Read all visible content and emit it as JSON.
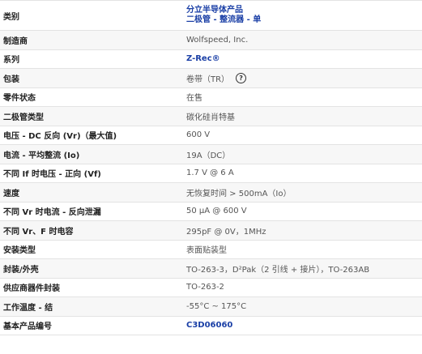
{
  "specs": [
    {
      "label": "类别",
      "value_line1": "分立半导体产品",
      "value_line2": "二极管 - 整流器 - 单"
    },
    {
      "label": "制造商",
      "value": "Wolfspeed, Inc."
    },
    {
      "label": "系列",
      "value": "Z-Rec®"
    },
    {
      "label": "包装",
      "value": "卷带（TR）",
      "help_icon": "question-circle-icon"
    },
    {
      "label": "零件状态",
      "value": "在售"
    },
    {
      "label": "二极管类型",
      "value": "碳化硅肖特基"
    },
    {
      "label": "电压 - DC 反向 (Vr)（最大值)",
      "value": "600 V"
    },
    {
      "label": "电流 - 平均整流 (Io)",
      "value": "19A（DC）"
    },
    {
      "label": "不同 If 时电压 - 正向 (Vf)",
      "value": "1.7 V @ 6 A"
    },
    {
      "label": "速度",
      "value": "无恢复时间 > 500mA（Io）"
    },
    {
      "label": "不同 Vr 时电流 - 反向泄漏",
      "value": "50 µA @ 600 V"
    },
    {
      "label": "不同 Vr、F 时电容",
      "value": "295pF @ 0V，1MHz"
    },
    {
      "label": "安装类型",
      "value": "表面贴装型"
    },
    {
      "label": "封装/外壳",
      "value": "TO-263-3，D²Pak（2 引线 + 接片），TO-263AB"
    },
    {
      "label": "供应商器件封装",
      "value": "TO-263-2"
    },
    {
      "label": "工作温度 - 结",
      "value": "-55°C ~ 175°C"
    },
    {
      "label": "基本产品编号",
      "value": "C3D06060"
    }
  ]
}
